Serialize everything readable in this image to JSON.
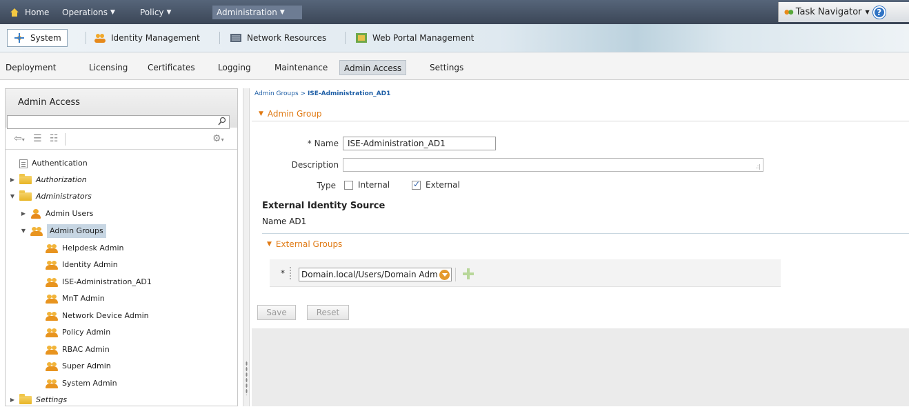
{
  "topnav": {
    "home": "Home",
    "operations": "Operations",
    "policy": "Policy",
    "administration": "Administration",
    "task_navigator": "Task Navigator"
  },
  "modules": {
    "system": "System",
    "identity_management": "Identity Management",
    "network_resources": "Network Resources",
    "web_portal_management": "Web Portal Management"
  },
  "subtabs": [
    "Deployment",
    "Licensing",
    "Certificates",
    "Logging",
    "Maintenance",
    "Admin Access",
    "Settings"
  ],
  "left_panel": {
    "title": "Admin Access",
    "search_value": "",
    "tree": {
      "authentication": "Authentication",
      "authorization": "Authorization",
      "administrators": "Administrators",
      "admin_users": "Admin Users",
      "admin_groups": "Admin Groups",
      "groups": [
        "Helpdesk Admin",
        "Identity Admin",
        "ISE-Administration_AD1",
        "MnT Admin",
        "Network Device Admin",
        "Policy Admin",
        "RBAC Admin",
        "Super Admin",
        "System Admin"
      ],
      "settings": "Settings"
    }
  },
  "content": {
    "breadcrumb_parent": "Admin Groups",
    "breadcrumb_sep": ">",
    "breadcrumb_current": "ISE-Administration_AD1",
    "section_admin_group": "Admin Group",
    "name_label": "Name",
    "name_required": "*",
    "name_value": "ISE-Administration_AD1",
    "description_label": "Description",
    "description_value": "",
    "type_label": "Type",
    "type_internal": "Internal",
    "type_internal_checked": false,
    "type_external": "External",
    "type_external_checked": true,
    "external_identity_source_title": "External Identity Source",
    "external_identity_source_name": "Name AD1",
    "section_external_groups": "External Groups",
    "external_group_required": "*",
    "external_group_value": "Domain.local/Users/Domain Adm",
    "save_label": "Save",
    "reset_label": "Reset"
  },
  "colors": {
    "accent_orange": "#e07a14",
    "link_blue": "#1f5fa6",
    "topnav_bg": "#3b4657"
  }
}
